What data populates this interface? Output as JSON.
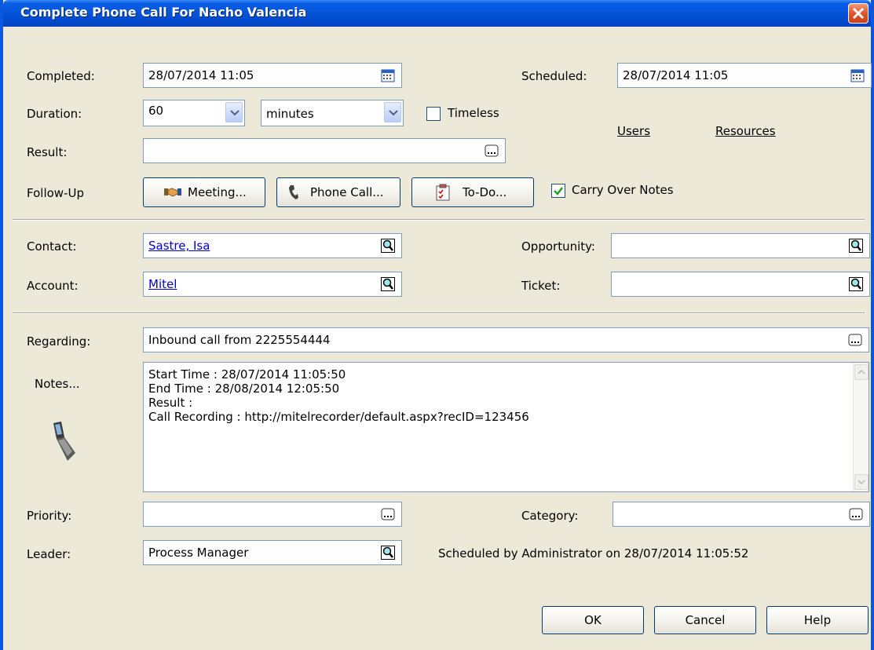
{
  "window": {
    "title": "Complete Phone Call For Nacho Valencia"
  },
  "completed": {
    "label": "Completed:",
    "value": "28/07/2014 11:05"
  },
  "scheduled": {
    "label": "Scheduled:",
    "value": "28/07/2014 11:05"
  },
  "duration": {
    "label": "Duration:",
    "value": "60",
    "unit": "minutes"
  },
  "timeless": {
    "label": "Timeless",
    "checked": false
  },
  "result": {
    "label": "Result:",
    "value": ""
  },
  "links": {
    "users": "Users",
    "resources": "Resources"
  },
  "followup": {
    "label": "Follow-Up",
    "meeting": "Meeting...",
    "phone_call": "Phone Call...",
    "todo": "To-Do..."
  },
  "carry_over": {
    "label": "Carry Over Notes",
    "checked": true
  },
  "contact": {
    "label": "Contact:",
    "value": "Sastre, Isa"
  },
  "account": {
    "label": "Account:",
    "value": "Mitel"
  },
  "opportunity": {
    "label": "Opportunity:",
    "value": ""
  },
  "ticket": {
    "label": "Ticket:",
    "value": ""
  },
  "regarding": {
    "label": "Regarding:",
    "value": "Inbound call from 2225554444"
  },
  "notes": {
    "label": "Notes...",
    "lines": [
      "Start Time : 28/07/2014 11:05:50",
      "End Time : 28/08/2014 12:05:50",
      "Result :",
      "Call Recording : http://mitelrecorder/default.aspx?recID=123456"
    ]
  },
  "priority": {
    "label": "Priority:",
    "value": ""
  },
  "category": {
    "label": "Category:",
    "value": ""
  },
  "leader": {
    "label": "Leader:",
    "value": "Process Manager"
  },
  "scheduled_by": "Scheduled by Administrator on 28/07/2014 11:05:52",
  "buttons": {
    "ok": "OK",
    "cancel": "Cancel",
    "help": "Help"
  },
  "colors": {
    "titlebar": "#0454d8",
    "dialog": "#ece9d8",
    "link": "#0000cc"
  }
}
